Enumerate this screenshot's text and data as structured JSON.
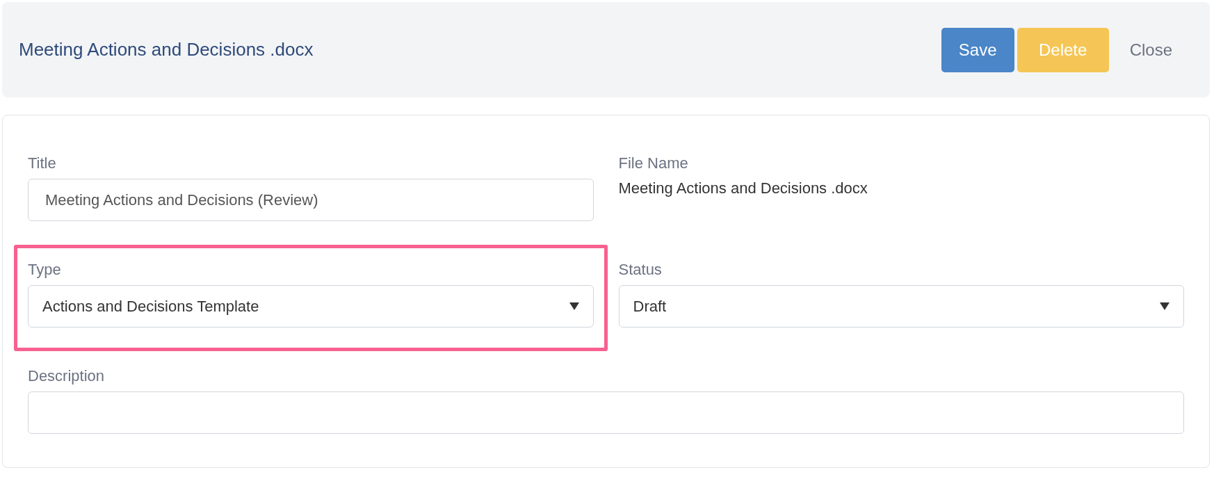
{
  "header": {
    "title": "Meeting Actions and Decisions .docx",
    "buttons": [
      {
        "label": "Save",
        "kind": "primary"
      },
      {
        "label": "Delete",
        "kind": "warning"
      },
      {
        "label": "Close",
        "kind": "plain"
      }
    ]
  },
  "form": {
    "rows": [
      [
        {
          "label": "Title",
          "kind": "input",
          "value": "Meeting Actions and Decisions (Review)",
          "highlighted": false
        },
        {
          "label": "File Name",
          "kind": "static",
          "value": "Meeting Actions and Decisions .docx",
          "highlighted": false
        }
      ],
      [
        {
          "label": "Type",
          "kind": "select",
          "value": "Actions and Decisions Template",
          "highlighted": true
        },
        {
          "label": "Status",
          "kind": "select",
          "value": "Draft",
          "highlighted": false
        }
      ],
      [
        {
          "label": "Description",
          "kind": "input",
          "highlighted": false
        }
      ]
    ]
  }
}
